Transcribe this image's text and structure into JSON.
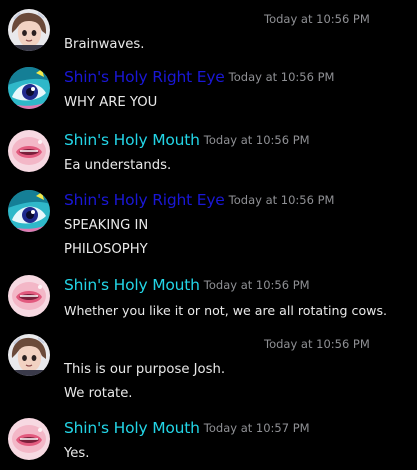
{
  "colors": {
    "background": "#000000",
    "name_right_eye": "#1a17d6",
    "name_mouth": "#23d5e6",
    "name_hidden": "#050508",
    "timestamp": "#8f9094",
    "text": "#e9e9e9"
  },
  "messages": [
    {
      "author": "",
      "author_color": "#050508",
      "avatar": "brown-hair-character-avatar-icon",
      "timestamp": "Today at 10:56 PM",
      "lines": [
        "Brainwaves."
      ]
    },
    {
      "author": "Shin's Holy Right Eye",
      "author_color": "#1a17d6",
      "avatar": "cyan-eye-avatar-icon",
      "timestamp": "Today at 10:56 PM",
      "lines": [
        "WHY ARE YOU"
      ]
    },
    {
      "author": "Shin's Holy Mouth",
      "author_color": "#23d5e6",
      "avatar": "pink-mouth-avatar-icon",
      "timestamp": "Today at 10:56 PM",
      "lines": [
        "Ea understands."
      ]
    },
    {
      "author": "Shin's Holy Right Eye",
      "author_color": "#1a17d6",
      "avatar": "cyan-eye-avatar-icon",
      "timestamp": "Today at 10:56 PM",
      "lines": [
        "SPEAKING IN",
        "PHILOSOPHY"
      ]
    },
    {
      "author": "Shin's Holy Mouth",
      "author_color": "#23d5e6",
      "avatar": "pink-mouth-avatar-icon",
      "timestamp": "Today at 10:56 PM",
      "lines": [
        "Whether you like it or not, we are all rotating cows."
      ]
    },
    {
      "author": "",
      "author_color": "#050508",
      "avatar": "brown-hair-character-avatar-icon",
      "timestamp": "Today at 10:56 PM",
      "lines": [
        "This is our purpose Josh.",
        "We rotate."
      ]
    },
    {
      "author": "Shin's Holy Mouth",
      "author_color": "#23d5e6",
      "avatar": "pink-mouth-avatar-icon",
      "timestamp": "Today at 10:57 PM",
      "lines": [
        "Yes."
      ]
    }
  ]
}
